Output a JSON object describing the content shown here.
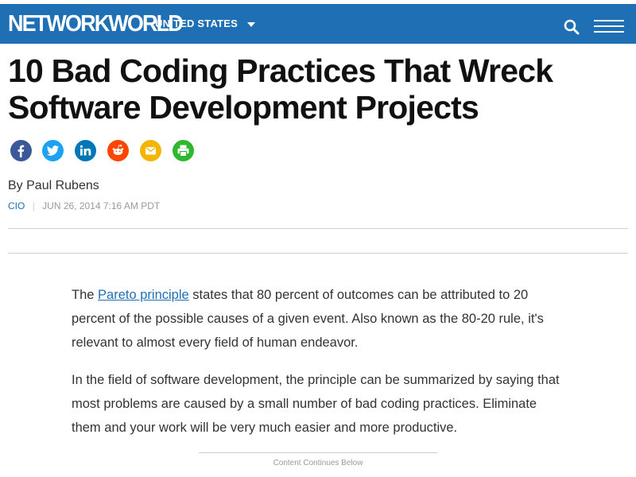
{
  "header": {
    "logo": "NETWORKWORLD",
    "region": "UNITED STATES",
    "search_icon": "search-icon",
    "menu_icon": "hamburger-menu-icon",
    "bg_color": "#1f6fb5"
  },
  "article": {
    "title_line1": "10 Bad Coding Practices That Wreck",
    "title_line2": "Software Development Projects",
    "share": [
      {
        "name": "facebook",
        "color": "#3b5998",
        "icon": "facebook-icon"
      },
      {
        "name": "twitter",
        "color": "#1da1f2",
        "icon": "twitter-icon"
      },
      {
        "name": "linkedin",
        "color": "#0077b5",
        "icon": "linkedin-icon"
      },
      {
        "name": "reddit",
        "color": "#ff4500",
        "icon": "reddit-icon"
      },
      {
        "name": "email",
        "color": "#f4b400",
        "icon": "email-icon"
      },
      {
        "name": "print",
        "color": "#2eb82e",
        "icon": "print-icon"
      }
    ],
    "byline": "By Paul Rubens",
    "category": "CIO",
    "separator": "|",
    "date": "JUN 26, 2014 7:16 AM PDT",
    "p1_before": "The ",
    "p1_link": "Pareto principle",
    "p1_after": " states that 80 percent of outcomes can be attributed to 20 percent of the possible causes of a given event. Also known as the 80-20 rule, it's relevant to almost every field of human endeavor.",
    "p2": "In the field of software development, the principle can be summarized by saying that most problems are caused by a small number of bad coding practices. Eliminate them and your work will be very much easier and more productive.",
    "continues": "Content Continues Below"
  }
}
